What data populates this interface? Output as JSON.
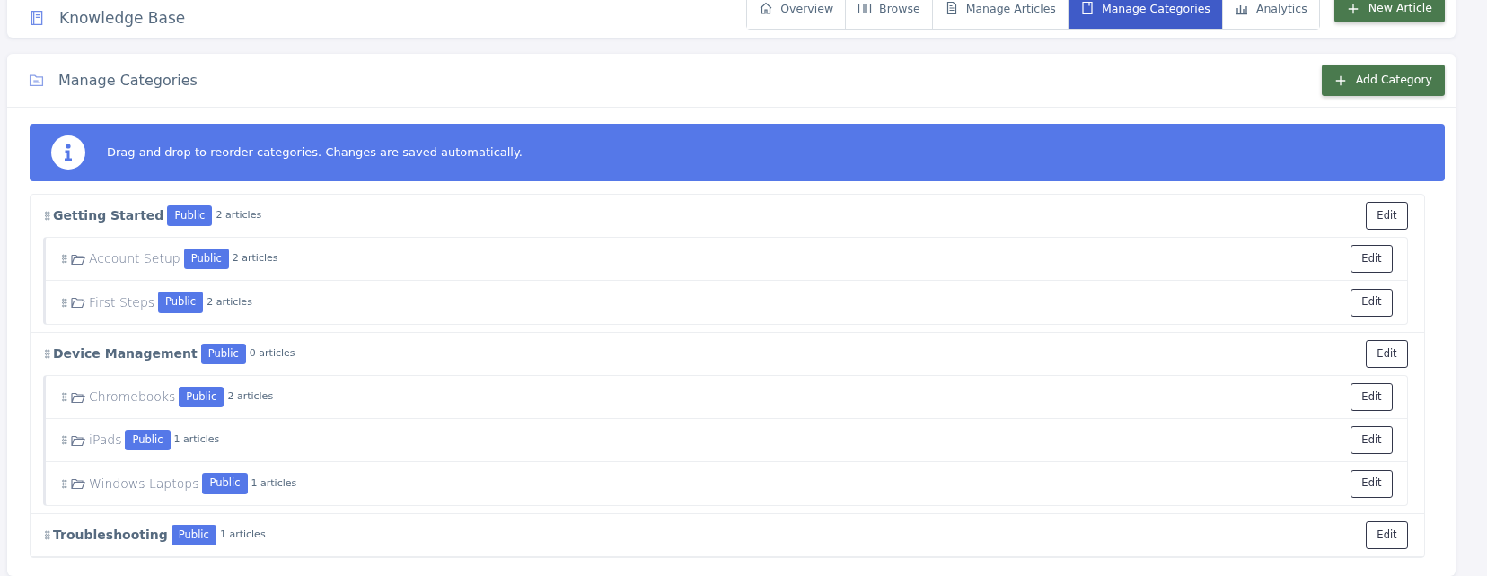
{
  "header": {
    "title": "Knowledge Base",
    "tabs": [
      {
        "label": "Overview",
        "selected": false
      },
      {
        "label": "Browse",
        "selected": false
      },
      {
        "label": "Manage Articles",
        "selected": false
      },
      {
        "label": "Manage Categories",
        "selected": true
      },
      {
        "label": "Analytics",
        "selected": false
      }
    ],
    "action": "New Article"
  },
  "panel": {
    "title": "Manage Categories",
    "action": "Add Category",
    "alert": "Drag and drop to reorder categories. Changes are saved automatically.",
    "categories": [
      {
        "name": "Getting Started",
        "visibility": "Public",
        "count": "2 articles",
        "edit": "Edit",
        "children": [
          {
            "name": "Account Setup",
            "visibility": "Public",
            "count": "2 articles",
            "edit": "Edit"
          },
          {
            "name": "First Steps",
            "visibility": "Public",
            "count": "2 articles",
            "edit": "Edit"
          }
        ]
      },
      {
        "name": "Device Management",
        "visibility": "Public",
        "count": "0 articles",
        "edit": "Edit",
        "children": [
          {
            "name": "Chromebooks",
            "visibility": "Public",
            "count": "2 articles",
            "edit": "Edit"
          },
          {
            "name": "iPads",
            "visibility": "Public",
            "count": "1 articles",
            "edit": "Edit"
          },
          {
            "name": "Windows Laptops",
            "visibility": "Public",
            "count": "1 articles",
            "edit": "Edit"
          }
        ]
      },
      {
        "name": "Troubleshooting",
        "visibility": "Public",
        "count": "1 articles",
        "edit": "Edit"
      }
    ]
  }
}
